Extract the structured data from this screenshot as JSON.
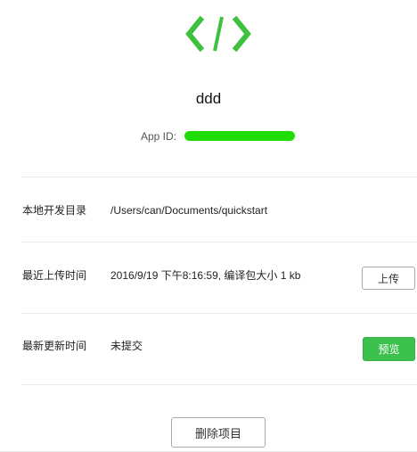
{
  "project": {
    "logo_icon": "code-brackets-icon",
    "name": "ddd",
    "app_id_label": "App ID:"
  },
  "info": {
    "directory": {
      "label": "本地开发目录",
      "value": "/Users/can/Documents/quickstart"
    },
    "last_upload": {
      "label": "最近上传时间",
      "value": "2016/9/19 下午8:16:59, 编译包大小 1 kb",
      "button_label": "上传"
    },
    "last_update": {
      "label": "最新更新时间",
      "value": "未提交",
      "button_label": "预览"
    }
  },
  "actions": {
    "delete_label": "删除项目"
  },
  "colors": {
    "accent": "#3cc14c",
    "logo": "#3ec13e",
    "redaction": "#1fdd00"
  }
}
